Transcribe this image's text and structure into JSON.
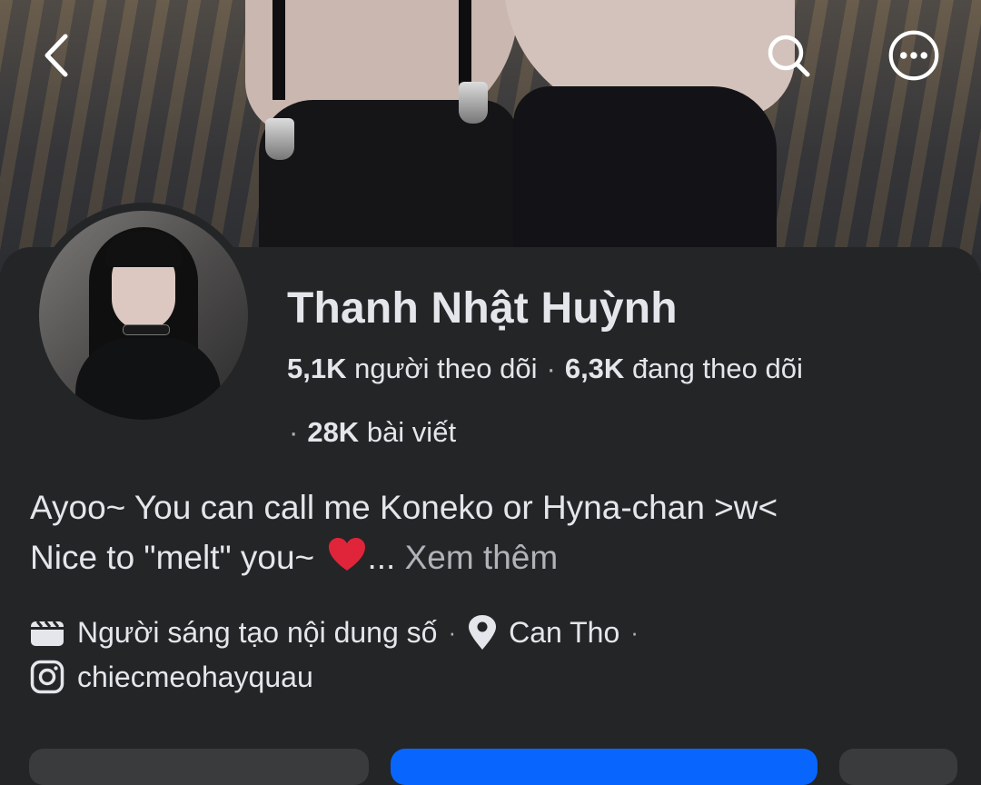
{
  "profile": {
    "name": "Thanh Nhật Huỳnh",
    "followers_count": "5,1K",
    "followers_label": "người theo dõi",
    "following_count": "6,3K",
    "following_label": "đang theo dõi",
    "posts_count": "28K",
    "posts_label": "bài viết"
  },
  "bio": {
    "line1": "Ayoo~ You can call me Koneko or Hyna-chan >w<",
    "line2": "Nice to \"melt\" you~ ",
    "ellipsis": "...",
    "see_more": "Xem thêm"
  },
  "details": {
    "category": "Người sáng tạo nội dung số",
    "location": "Can Tho",
    "instagram": "chiecmeohayquau",
    "separator": "·"
  },
  "icons": {
    "back": "chevron-left-icon",
    "search": "search-icon",
    "more": "more-options-icon",
    "category": "clapperboard-icon",
    "location": "location-pin-icon",
    "instagram": "instagram-icon",
    "heart": "red-heart-icon"
  },
  "colors": {
    "background": "#242526",
    "text": "#e4e6eb",
    "muted": "#b0b3b8",
    "primary_button": "#0866ff",
    "secondary_button": "#3a3b3c"
  }
}
